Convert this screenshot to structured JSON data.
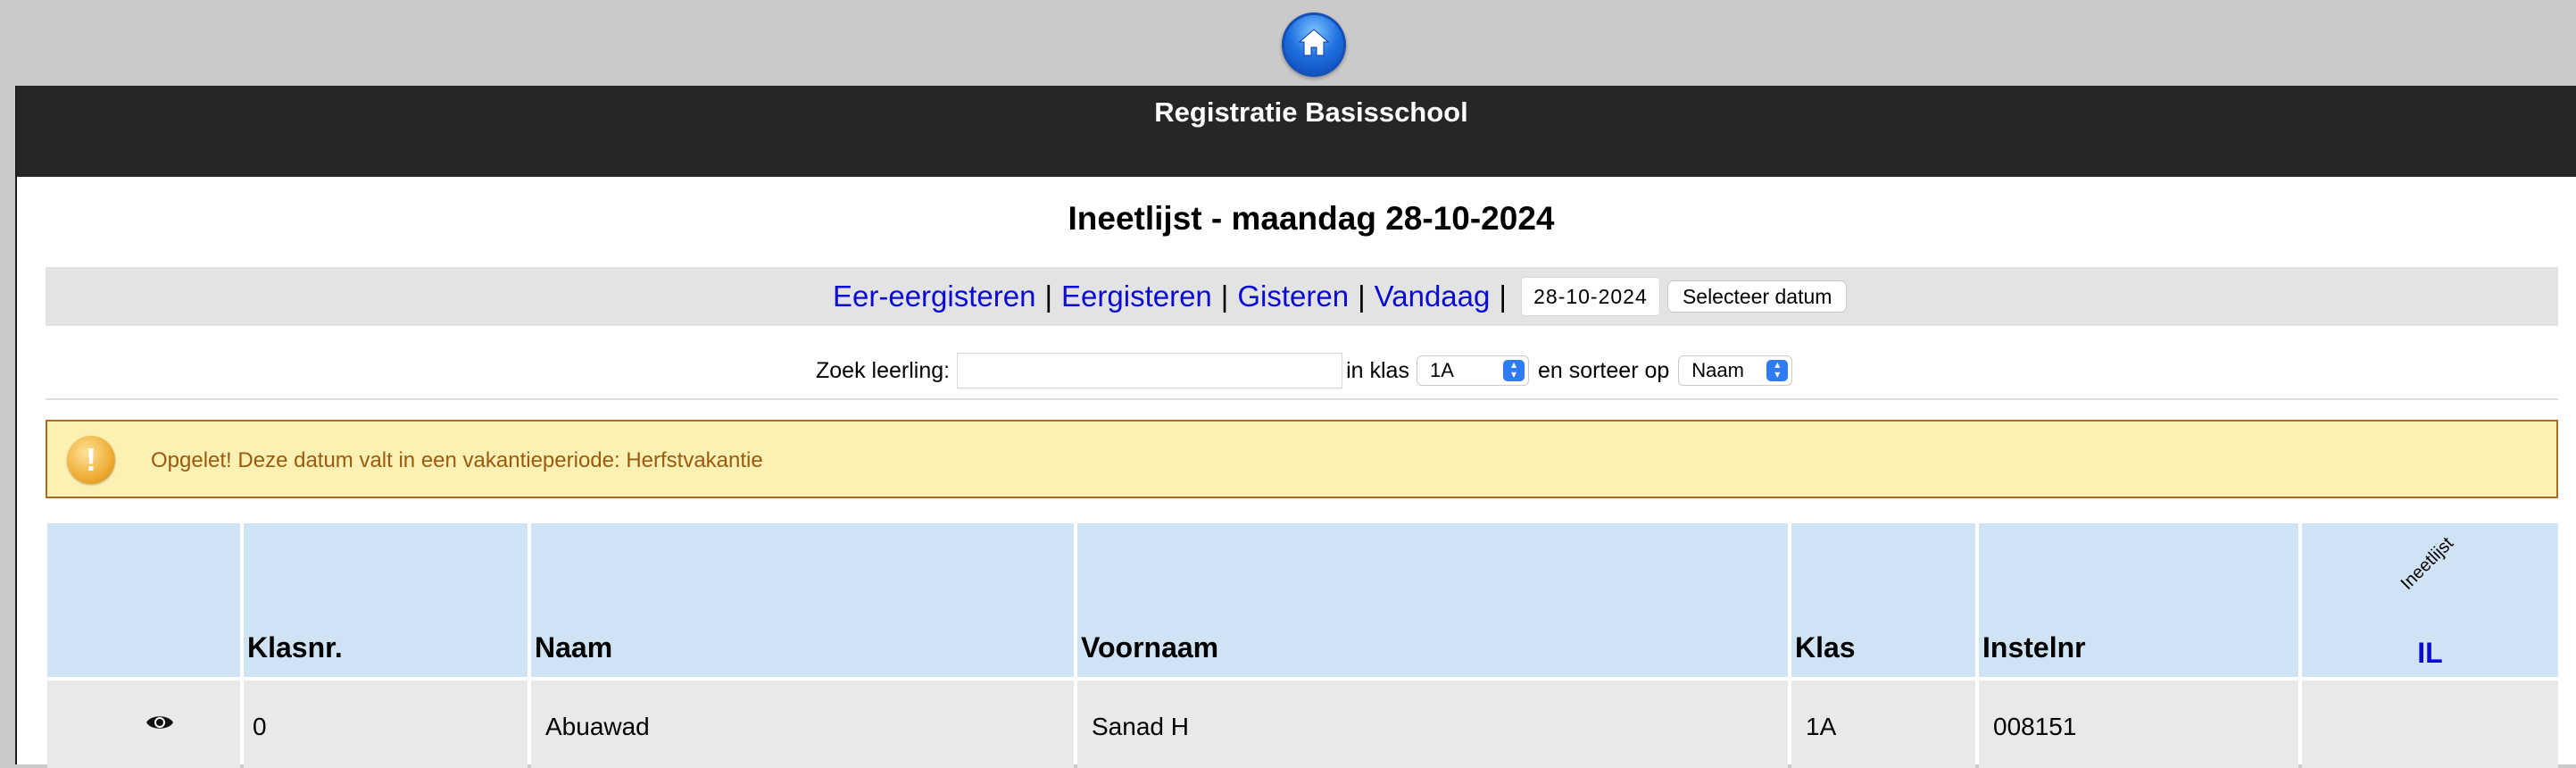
{
  "nav": {
    "home_icon": "home-icon"
  },
  "header": {
    "title": "Registratie Basisschool"
  },
  "page": {
    "title": "Ineetlijst - maandag 28-10-2024"
  },
  "date_nav": {
    "links": [
      "Eer-eergisteren",
      "Eergisteren",
      "Gisteren",
      "Vandaag"
    ],
    "separator": "|",
    "date_value": "28-10-2024",
    "select_button": "Selecteer datum"
  },
  "search": {
    "label": "Zoek leerling:",
    "value": "",
    "class_label": "in klas",
    "class_value": "1A",
    "sort_label": "en sorteer op",
    "sort_value": "Naam"
  },
  "alert": {
    "icon": "warning-icon",
    "text": "Opgelet! Deze datum valt in een vakantieperiode: Herfstvakantie",
    "colors": {
      "background": "#fdf0b3",
      "border": "#b06a22",
      "text": "#9a5a10"
    }
  },
  "table": {
    "columns": [
      "",
      "Klasnr.",
      "Naam",
      "Voornaam",
      "Klas",
      "Instelnr"
    ],
    "il_column": {
      "rotated_label": "Ineetlijst",
      "label": "IL"
    },
    "rows": [
      {
        "icon": "eye-icon",
        "klasnr": "0",
        "naam": "Abuawad",
        "voornaam": "Sanad H",
        "klas": "1A",
        "instelnr": "008151",
        "il": ""
      }
    ],
    "colors": {
      "header_bg": "#cfe3f5",
      "row_bg": "#e9e9e9",
      "link": "#0b0bd6"
    }
  }
}
